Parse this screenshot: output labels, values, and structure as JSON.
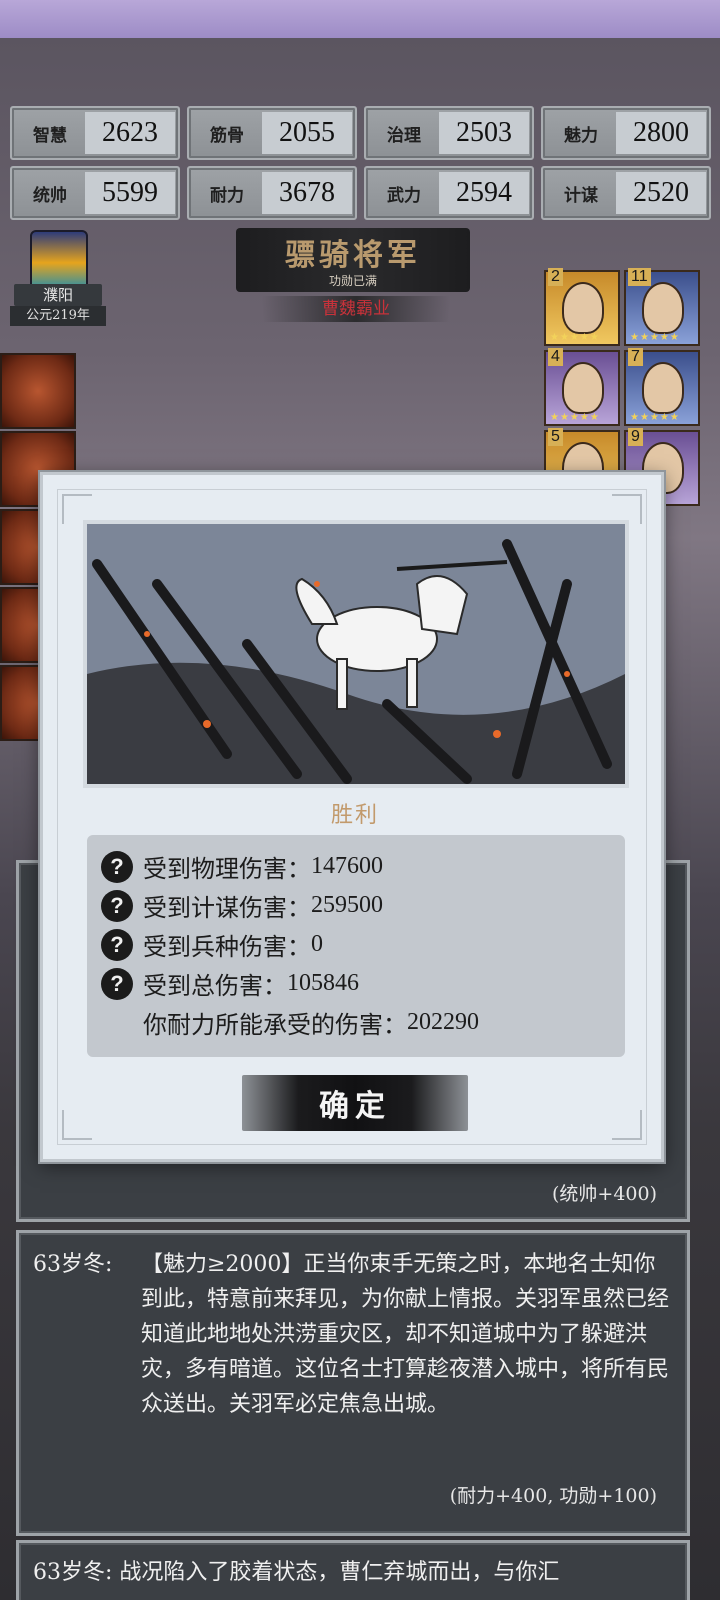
{
  "stats": [
    {
      "label": "智慧",
      "value": "2623"
    },
    {
      "label": "筋骨",
      "value": "2055"
    },
    {
      "label": "治理",
      "value": "2503"
    },
    {
      "label": "魅力",
      "value": "2800"
    },
    {
      "label": "统帅",
      "value": "5599"
    },
    {
      "label": "耐力",
      "value": "3678"
    },
    {
      "label": "武力",
      "value": "2594"
    },
    {
      "label": "计谋",
      "value": "2520"
    }
  ],
  "city": {
    "name": "濮阳",
    "year": "公元219年"
  },
  "rank": {
    "title": "骠骑将军",
    "subtitle": "功勋已满",
    "faction": "曹魏霸业"
  },
  "generals": [
    {
      "num": "2",
      "tone": "gold"
    },
    {
      "num": "11",
      "tone": "blue"
    },
    {
      "num": "4",
      "tone": "purple"
    },
    {
      "num": "7",
      "tone": "blue"
    },
    {
      "num": "5",
      "tone": "gold"
    },
    {
      "num": "9",
      "tone": "purple"
    }
  ],
  "modal": {
    "result_title": "胜利",
    "rows": [
      {
        "label": "受到物理伤害：",
        "value": "147600",
        "icon": "help-icon"
      },
      {
        "label": "受到计谋伤害：",
        "value": "259500",
        "icon": "help-icon"
      },
      {
        "label": "受到兵种伤害：",
        "value": "0",
        "icon": "help-icon"
      },
      {
        "label": "受到总伤害：",
        "value": "105846",
        "icon": "help-icon"
      }
    ],
    "capacity_label": "你耐力所能承受的伤害：",
    "capacity_value": "202290",
    "confirm_label": "确定"
  },
  "log": {
    "card1_reward": "(统帅+400)",
    "card2_age": "63岁冬:",
    "card2_text": "【魅力≥2000】正当你束手无策之时，本地名士知你到此，特意前来拜见，为你献上情报。关羽军虽然已经知道此地地处洪涝重灾区，却不知道城中为了躲避洪灾，多有暗道。这位名士打算趁夜潜入城中，将所有民众送出。关羽军必定焦急出城。",
    "card2_reward": "(耐力+400, 功勋+100)",
    "card3_text": "63岁冬:    战况陷入了胶着状态，曹仁弃城而出，与你汇"
  }
}
